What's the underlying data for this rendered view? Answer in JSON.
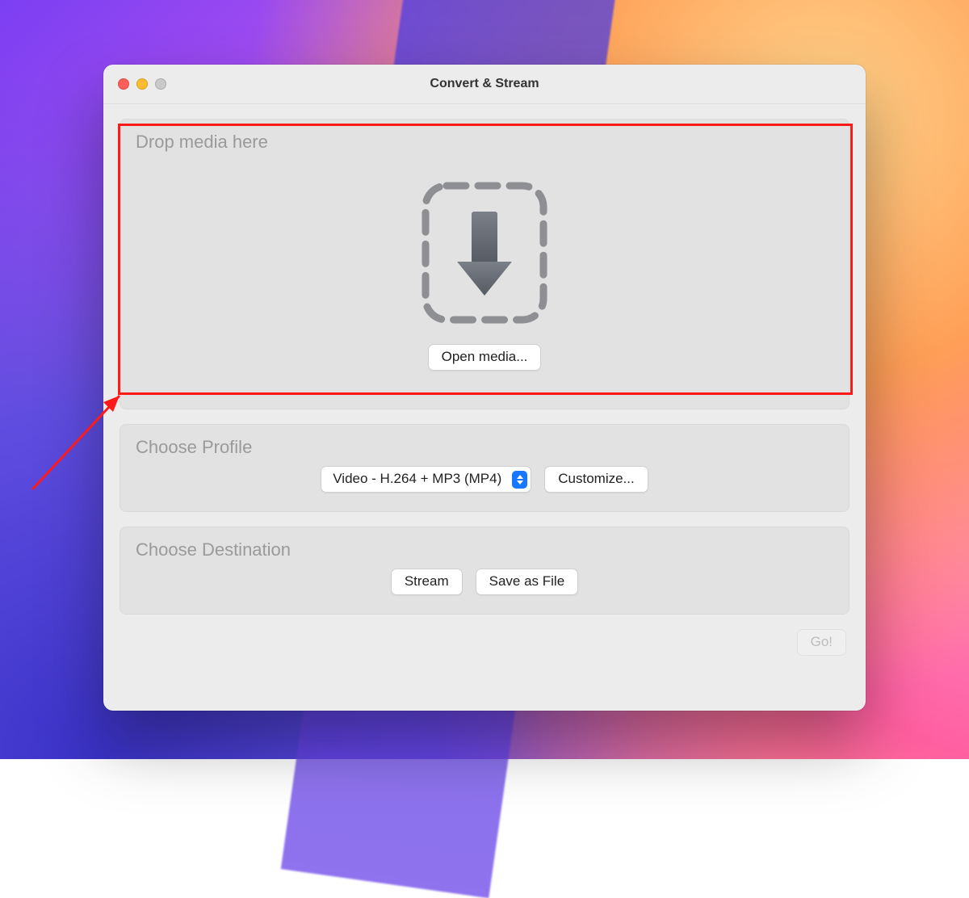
{
  "window": {
    "title": "Convert & Stream"
  },
  "drop": {
    "section_label": "Drop media here",
    "open_label": "Open media..."
  },
  "profile": {
    "section_label": "Choose Profile",
    "selected": "Video - H.264 + MP3 (MP4)",
    "customize_label": "Customize..."
  },
  "destination": {
    "section_label": "Choose Destination",
    "stream_label": "Stream",
    "save_label": "Save as File"
  },
  "footer": {
    "go_label": "Go!"
  },
  "annotation": {
    "highlight_color": "#ff1a1a"
  }
}
